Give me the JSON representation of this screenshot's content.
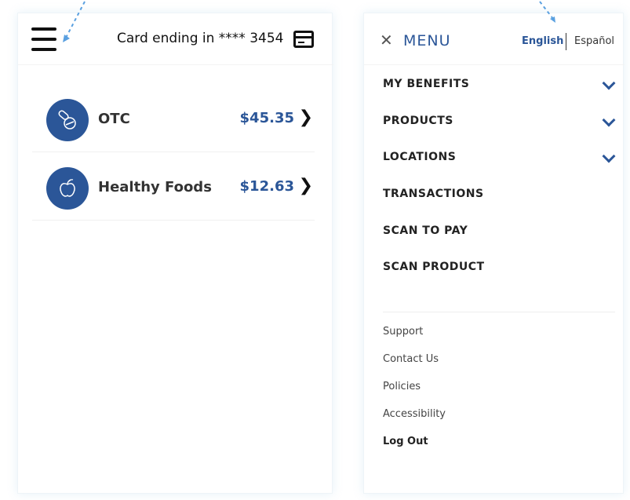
{
  "left": {
    "card_label": "Card ending in **** 3454",
    "balances": [
      {
        "name": "OTC",
        "amount": "$45.35",
        "icon": "pills-icon"
      },
      {
        "name": "Healthy Foods",
        "amount": "$12.63",
        "icon": "apple-icon"
      }
    ]
  },
  "menu": {
    "title": "MENU",
    "languages": {
      "english": "English",
      "spanish": "Español"
    },
    "items": [
      {
        "label": "MY BENEFITS",
        "expandable": true
      },
      {
        "label": "PRODUCTS",
        "expandable": true
      },
      {
        "label": "LOCATIONS",
        "expandable": true
      },
      {
        "label": "TRANSACTIONS",
        "expandable": false
      },
      {
        "label": "SCAN TO PAY",
        "expandable": false
      },
      {
        "label": "SCAN PRODUCT",
        "expandable": false
      }
    ],
    "footer": [
      {
        "label": "Support"
      },
      {
        "label": "Contact Us"
      },
      {
        "label": "Policies"
      },
      {
        "label": "Accessibility"
      },
      {
        "label": "Log Out"
      }
    ]
  },
  "colors": {
    "accent": "#2b5698",
    "annotation": "#5aa0e0"
  }
}
